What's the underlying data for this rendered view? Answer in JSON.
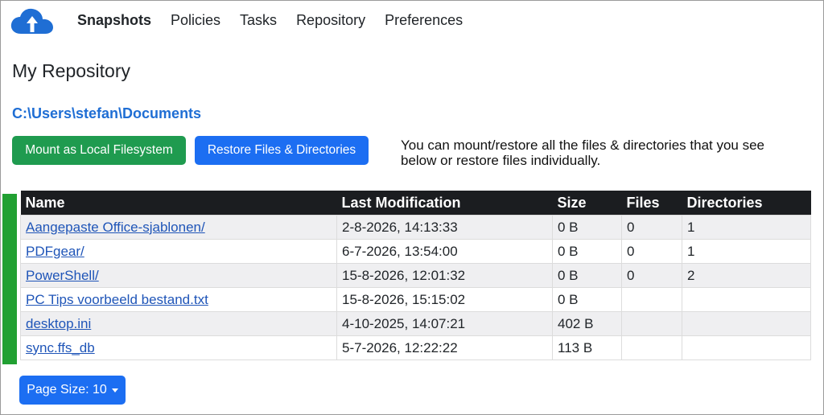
{
  "nav": {
    "items": [
      {
        "label": "Snapshots"
      },
      {
        "label": "Policies"
      },
      {
        "label": "Tasks"
      },
      {
        "label": "Repository"
      },
      {
        "label": "Preferences"
      }
    ]
  },
  "main": {
    "title": "My Repository",
    "path": "C:\\Users\\stefan\\Documents",
    "mount_label": "Mount as Local Filesystem",
    "restore_label": "Restore Files & Directories",
    "hint": "You can mount/restore all the files & directories that you see below or restore files individually."
  },
  "table": {
    "headers": [
      "Name",
      "Last Modification",
      "Size",
      "Files",
      "Directories"
    ],
    "rows": [
      {
        "name": "Aangepaste Office-sjablonen/",
        "modified": "2-8-2026, 14:13:33",
        "size": "0 B",
        "files": "0",
        "dirs": "1"
      },
      {
        "name": "PDFgear/",
        "modified": "6-7-2026, 13:54:00",
        "size": "0 B",
        "files": "0",
        "dirs": "1"
      },
      {
        "name": "PowerShell/",
        "modified": "15-8-2026, 12:01:32",
        "size": "0 B",
        "files": "0",
        "dirs": "2"
      },
      {
        "name": "PC Tips voorbeeld bestand.txt",
        "modified": "15-8-2026, 15:15:02",
        "size": "0 B",
        "files": "",
        "dirs": ""
      },
      {
        "name": "desktop.ini",
        "modified": "4-10-2025, 14:07:21",
        "size": "402 B",
        "files": "",
        "dirs": ""
      },
      {
        "name": "sync.ffs_db",
        "modified": "5-7-2026, 12:22:22",
        "size": "113 B",
        "files": "",
        "dirs": ""
      }
    ]
  },
  "pager": {
    "label": "Page Size: 10"
  },
  "colors": {
    "green": "#1f9b4f",
    "blue": "#1c6ef2",
    "link": "#1f55b8",
    "header": "#1b1d20"
  }
}
